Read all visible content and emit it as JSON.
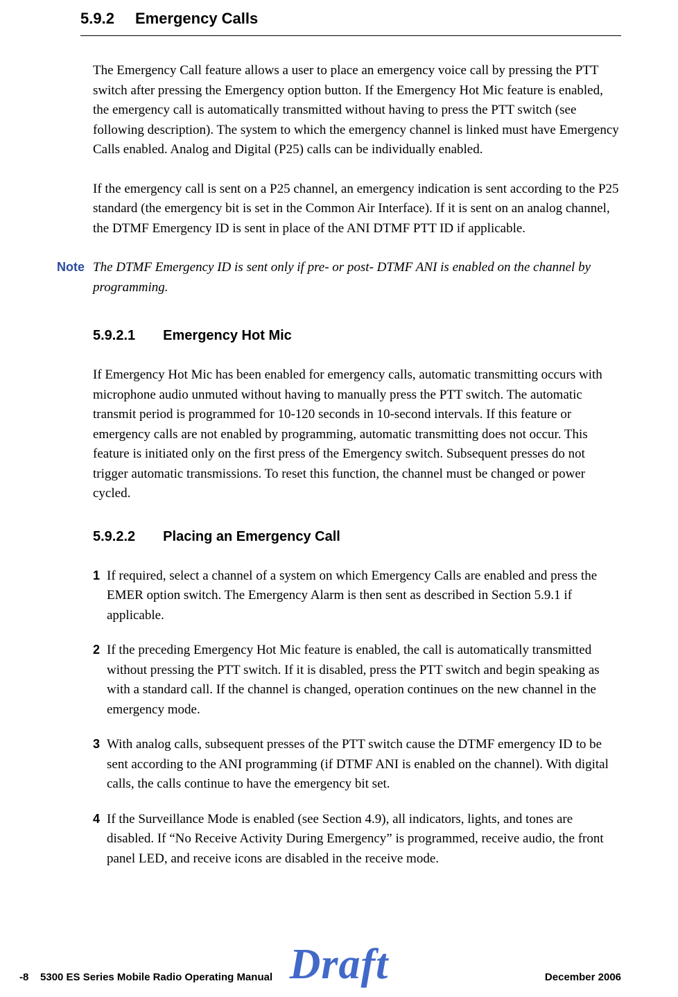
{
  "heading": {
    "number": "5.9.2",
    "title": "Emergency Calls"
  },
  "para1": "The Emergency Call feature allows a user to place an emergency voice call by pressing the PTT switch after pressing the Emergency option button. If the Emergency Hot Mic feature is enabled, the emergency call is automatically transmitted without having to press the PTT switch (see following description). The system to which the emergency channel is linked must have Emergency Calls enabled. Analog and Digital (P25) calls can be individually enabled.",
  "para2": "If the emergency call is sent on a P25 channel, an emergency indication is sent according to the P25 standard (the emergency bit is set in the Common Air Interface). If it is sent on an analog channel, the DTMF Emergency ID is sent in place of the ANI DTMF PTT ID if applicable.",
  "note": {
    "label": "Note",
    "text": "The DTMF Emergency ID is sent only if pre- or post- DTMF ANI is enabled on the channel by programming."
  },
  "sub1": {
    "number": "5.9.2.1",
    "title": "Emergency Hot Mic"
  },
  "sub1_para": "If Emergency Hot Mic has been enabled for emergency calls, automatic transmitting occurs with microphone audio unmuted without having to manually press the PTT switch. The automatic transmit period is programmed for 10-120 seconds in 10-second intervals. If this feature or emergency calls are not enabled by programming, automatic transmitting does not occur. This feature is initiated only on the first press of the Emergency switch. Subsequent presses do not trigger automatic transmissions. To reset this function, the channel must be changed or power cycled.",
  "sub2": {
    "number": "5.9.2.2",
    "title": "Placing an Emergency Call"
  },
  "steps": [
    {
      "num": "1",
      "text": "If required, select a channel of a system on which Emergency Calls are enabled and press the EMER option switch. The Emergency Alarm is then sent as described in Section 5.9.1 if applicable."
    },
    {
      "num": "2",
      "text": "If the preceding Emergency Hot Mic feature is enabled, the call is automatically transmitted without pressing the PTT switch. If it is disabled, press the PTT switch and begin speaking as with a standard call. If the channel is changed, operation continues on the new channel in the emergency mode."
    },
    {
      "num": "3",
      "text": "With analog calls, subsequent presses of the PTT switch cause the DTMF emergency ID to be sent according to the ANI programming (if DTMF ANI is enabled on the channel). With digital calls, the calls continue to have the emergency bit set."
    },
    {
      "num": "4",
      "text": "If the Surveillance Mode is enabled (see Section 4.9), all indicators, lights, and tones are disabled. If “No Receive Activity During Emergency” is programmed, receive audio, the front panel LED, and receive icons are disabled in the receive mode."
    }
  ],
  "footer": {
    "page": "-8",
    "manual": "5300 ES Series Mobile Radio Operating Manual",
    "date": "December 2006",
    "watermark": "Draft"
  }
}
